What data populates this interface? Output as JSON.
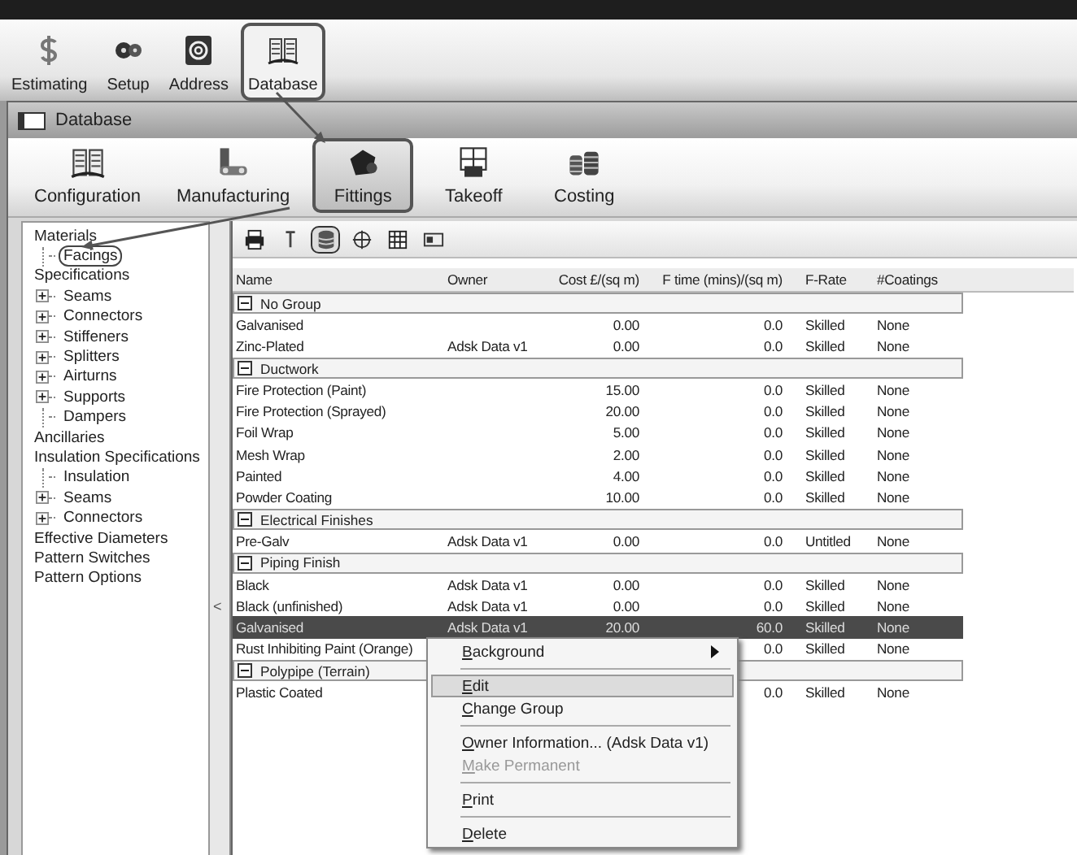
{
  "app_toolbar": [
    {
      "kind": "dollar",
      "label": "Estimating",
      "selected": false
    },
    {
      "kind": "gears",
      "label": "Setup",
      "selected": false
    },
    {
      "kind": "at",
      "label": "Address",
      "selected": false
    },
    {
      "kind": "book",
      "label": "Database",
      "selected": true
    }
  ],
  "window": {
    "title": "Database"
  },
  "ribbon": [
    {
      "kind": "book",
      "label": "Configuration",
      "selected": false
    },
    {
      "kind": "machine",
      "label": "Manufacturing",
      "selected": false
    },
    {
      "kind": "fitting",
      "label": "Fittings",
      "selected": true
    },
    {
      "kind": "takeoff",
      "label": "Takeoff",
      "selected": false
    },
    {
      "kind": "coins",
      "label": "Costing",
      "selected": false
    }
  ],
  "tree": [
    {
      "label": "Materials",
      "selected": false,
      "children": [
        {
          "label": "Facings",
          "selected": true
        }
      ]
    },
    {
      "label": "Specifications",
      "selected": false,
      "children": [
        {
          "label": "Seams",
          "selected": false,
          "expanded": false
        },
        {
          "label": "Connectors",
          "selected": false,
          "expanded": false
        },
        {
          "label": "Stiffeners",
          "selected": false,
          "expanded": false
        },
        {
          "label": "Splitters",
          "selected": false,
          "expanded": false
        },
        {
          "label": "Airturns",
          "selected": false,
          "expanded": false
        },
        {
          "label": "Supports",
          "selected": false,
          "expanded": false
        },
        {
          "label": "Dampers",
          "selected": false
        }
      ]
    },
    {
      "label": "Ancillaries",
      "selected": false
    },
    {
      "label": "Insulation Specifications",
      "selected": false,
      "children": [
        {
          "label": "Insulation",
          "selected": false
        },
        {
          "label": "Seams",
          "selected": false,
          "expanded": false
        },
        {
          "label": "Connectors",
          "selected": false,
          "expanded": false
        }
      ]
    },
    {
      "label": "Effective Diameters",
      "selected": false
    },
    {
      "label": "Pattern Switches",
      "selected": false
    },
    {
      "label": "Pattern Options",
      "selected": false
    }
  ],
  "splitter": {
    "glyph": "<"
  },
  "pane_toolbar": [
    {
      "kind": "printer",
      "selected": false
    },
    {
      "kind": "pin",
      "selected": false
    },
    {
      "kind": "database",
      "selected": true
    },
    {
      "kind": "grid",
      "selected": false
    },
    {
      "kind": "table",
      "selected": false
    },
    {
      "kind": "card",
      "selected": false
    }
  ],
  "table": {
    "columns": [
      "Name",
      "Owner",
      "Cost £/(sq m)",
      "F time (mins)/(sq m)",
      "F-Rate",
      "#Coatings"
    ],
    "groups": [
      {
        "name": "No Group",
        "expanded": true,
        "rows": [
          {
            "name": "Galvanised",
            "owner": "",
            "cost": "0.00",
            "ftime": "0.0",
            "frate": "Skilled",
            "coatings": "None",
            "selected": false
          },
          {
            "name": "Zinc-Plated",
            "owner": "Adsk Data v1",
            "cost": "0.00",
            "ftime": "0.0",
            "frate": "Skilled",
            "coatings": "None",
            "selected": false
          }
        ]
      },
      {
        "name": "Ductwork",
        "expanded": true,
        "rows": [
          {
            "name": "Fire Protection (Paint)",
            "owner": "",
            "cost": "15.00",
            "ftime": "0.0",
            "frate": "Skilled",
            "coatings": "None",
            "selected": false
          },
          {
            "name": "Fire Protection (Sprayed)",
            "owner": "",
            "cost": "20.00",
            "ftime": "0.0",
            "frate": "Skilled",
            "coatings": "None",
            "selected": false
          },
          {
            "name": "Foil Wrap",
            "owner": "",
            "cost": "5.00",
            "ftime": "0.0",
            "frate": "Skilled",
            "coatings": "None",
            "selected": false
          },
          {
            "name": "Mesh Wrap",
            "owner": "",
            "cost": "2.00",
            "ftime": "0.0",
            "frate": "Skilled",
            "coatings": "None",
            "selected": false
          },
          {
            "name": "Painted",
            "owner": "",
            "cost": "4.00",
            "ftime": "0.0",
            "frate": "Skilled",
            "coatings": "None",
            "selected": false
          },
          {
            "name": "Powder Coating",
            "owner": "",
            "cost": "10.00",
            "ftime": "0.0",
            "frate": "Skilled",
            "coatings": "None",
            "selected": false
          }
        ]
      },
      {
        "name": "Electrical Finishes",
        "expanded": true,
        "rows": [
          {
            "name": "Pre-Galv",
            "owner": "Adsk Data v1",
            "cost": "0.00",
            "ftime": "0.0",
            "frate": "Untitled",
            "coatings": "None",
            "selected": false
          }
        ]
      },
      {
        "name": "Piping Finish",
        "expanded": true,
        "rows": [
          {
            "name": "Black",
            "owner": "Adsk Data v1",
            "cost": "0.00",
            "ftime": "0.0",
            "frate": "Skilled",
            "coatings": "None",
            "selected": false
          },
          {
            "name": "Black (unfinished)",
            "owner": "Adsk Data v1",
            "cost": "0.00",
            "ftime": "0.0",
            "frate": "Skilled",
            "coatings": "None",
            "selected": false
          },
          {
            "name": "Galvanised",
            "owner": "Adsk Data v1",
            "cost": "20.00",
            "ftime": "60.0",
            "frate": "Skilled",
            "coatings": "None",
            "selected": true
          },
          {
            "name": "Rust Inhibiting Paint (Orange)",
            "owner": "",
            "cost": "",
            "ftime": "0.0",
            "frate": "Skilled",
            "coatings": "None",
            "selected": false
          }
        ]
      },
      {
        "name": "Polypipe (Terrain)",
        "expanded": true,
        "rows": [
          {
            "name": "Plastic Coated",
            "owner": "",
            "cost": "",
            "ftime": "0.0",
            "frate": "Skilled",
            "coatings": "None",
            "selected": false
          }
        ]
      }
    ]
  },
  "context_menu": [
    {
      "kind": "item",
      "label": "Background",
      "submenu": true,
      "selected": false,
      "disabled": false
    },
    {
      "kind": "separator"
    },
    {
      "kind": "item",
      "label": "Edit",
      "submenu": false,
      "selected": true,
      "disabled": false
    },
    {
      "kind": "item",
      "label": "Change Group",
      "submenu": false,
      "selected": false,
      "disabled": false
    },
    {
      "kind": "separator"
    },
    {
      "kind": "item",
      "label": "Owner Information... (Adsk Data v1)",
      "submenu": false,
      "selected": false,
      "disabled": false
    },
    {
      "kind": "item",
      "label": "Make Permanent",
      "submenu": false,
      "selected": false,
      "disabled": true
    },
    {
      "kind": "separator"
    },
    {
      "kind": "item",
      "label": "Print",
      "submenu": false,
      "selected": false,
      "disabled": false
    },
    {
      "kind": "separator"
    },
    {
      "kind": "item",
      "label": "Delete",
      "submenu": false,
      "selected": false,
      "disabled": false
    }
  ]
}
